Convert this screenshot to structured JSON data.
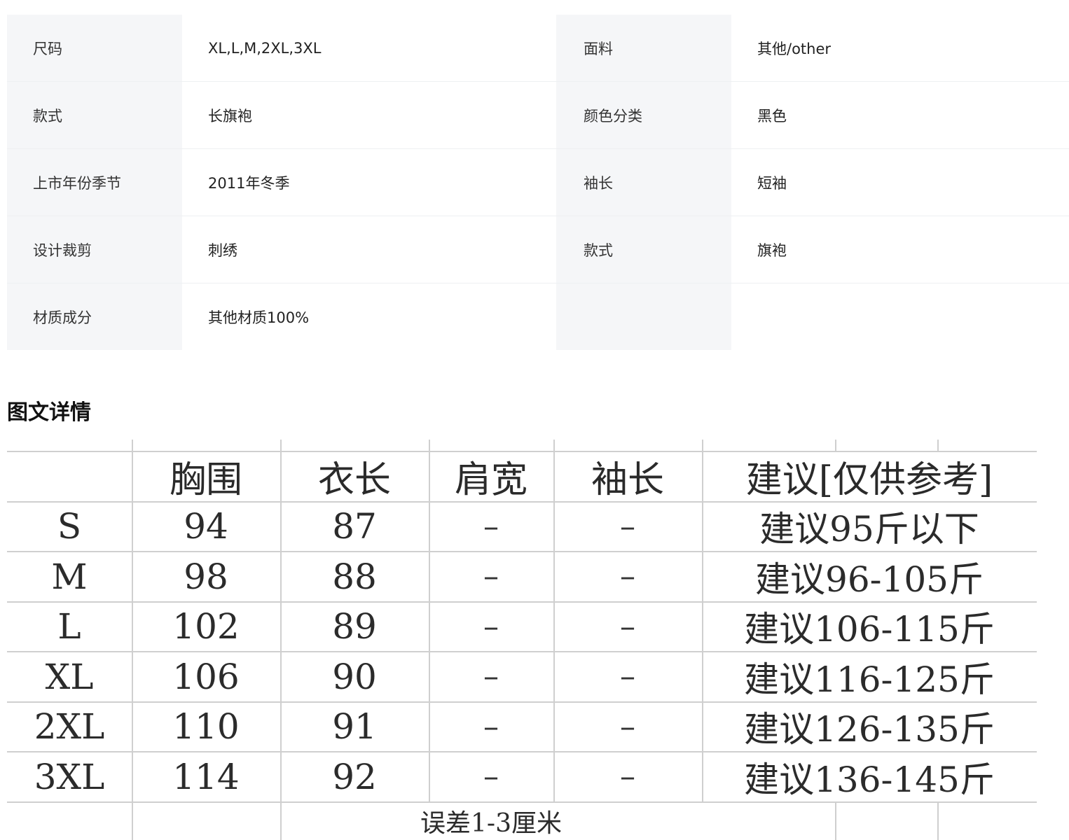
{
  "attributes": {
    "rows": [
      [
        {
          "key": "尺码",
          "value": "XL,L,M,2XL,3XL"
        },
        {
          "key": "面料",
          "value": "其他/other"
        }
      ],
      [
        {
          "key": "款式",
          "value": "长旗袍"
        },
        {
          "key": "颜色分类",
          "value": "黑色"
        }
      ],
      [
        {
          "key": "上市年份季节",
          "value": "2011年冬季"
        },
        {
          "key": "袖长",
          "value": "短袖"
        }
      ],
      [
        {
          "key": "设计裁剪",
          "value": "刺绣"
        },
        {
          "key": "款式",
          "value": "旗袍"
        }
      ],
      [
        {
          "key": "材质成分",
          "value": "其他材质100%"
        },
        {
          "key": "",
          "value": ""
        }
      ]
    ]
  },
  "section": {
    "title": "图文详情"
  },
  "size_chart": {
    "headers": [
      "",
      "胸围",
      "衣长",
      "肩宽",
      "袖长",
      "建议[仅供参考]"
    ],
    "rows": [
      [
        "S",
        "94",
        "87",
        "–",
        "–",
        "建议95斤以下"
      ],
      [
        "M",
        "98",
        "88",
        "–",
        "–",
        "建议96-105斤"
      ],
      [
        "L",
        "102",
        "89",
        "–",
        "–",
        "建议106-115斤"
      ],
      [
        "XL",
        "106",
        "90",
        "–",
        "–",
        "建议116-125斤"
      ],
      [
        "2XL",
        "110",
        "91",
        "–",
        "–",
        "建议126-135斤"
      ],
      [
        "3XL",
        "114",
        "92",
        "–",
        "–",
        "建议136-145斤"
      ]
    ],
    "note": "误差1-3厘米"
  }
}
